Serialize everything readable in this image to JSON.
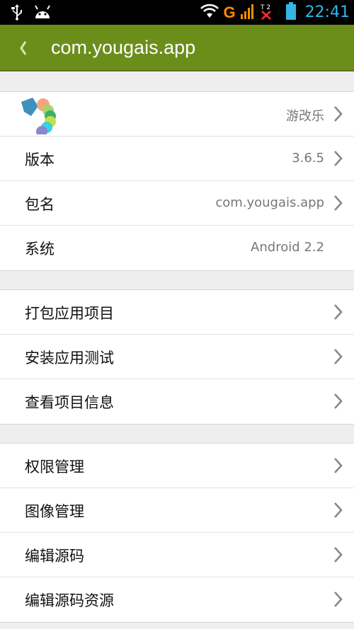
{
  "status_bar": {
    "time": "22:41",
    "network_letter": "G",
    "icons": [
      "usb-icon",
      "android-icon",
      "wifi-icon",
      "signal-icon",
      "no-signal-icon",
      "battery-icon"
    ],
    "time_color": "#33b5e5"
  },
  "action_bar": {
    "title": "com.yougais.app",
    "background_color": "#6b8e1b"
  },
  "info_group": {
    "app_name": "游改乐",
    "rows": [
      {
        "label": "版本",
        "value": "3.6.5"
      },
      {
        "label": "包名",
        "value": "com.yougais.app"
      },
      {
        "label": "系统",
        "value": "Android 2.2"
      }
    ]
  },
  "project_group": {
    "rows": [
      {
        "label": "打包应用项目"
      },
      {
        "label": "安装应用测试"
      },
      {
        "label": "查看项目信息"
      }
    ]
  },
  "manage_group": {
    "rows": [
      {
        "label": "权限管理"
      },
      {
        "label": "图像管理"
      },
      {
        "label": "编辑源码"
      },
      {
        "label": "编辑源码资源"
      }
    ]
  }
}
